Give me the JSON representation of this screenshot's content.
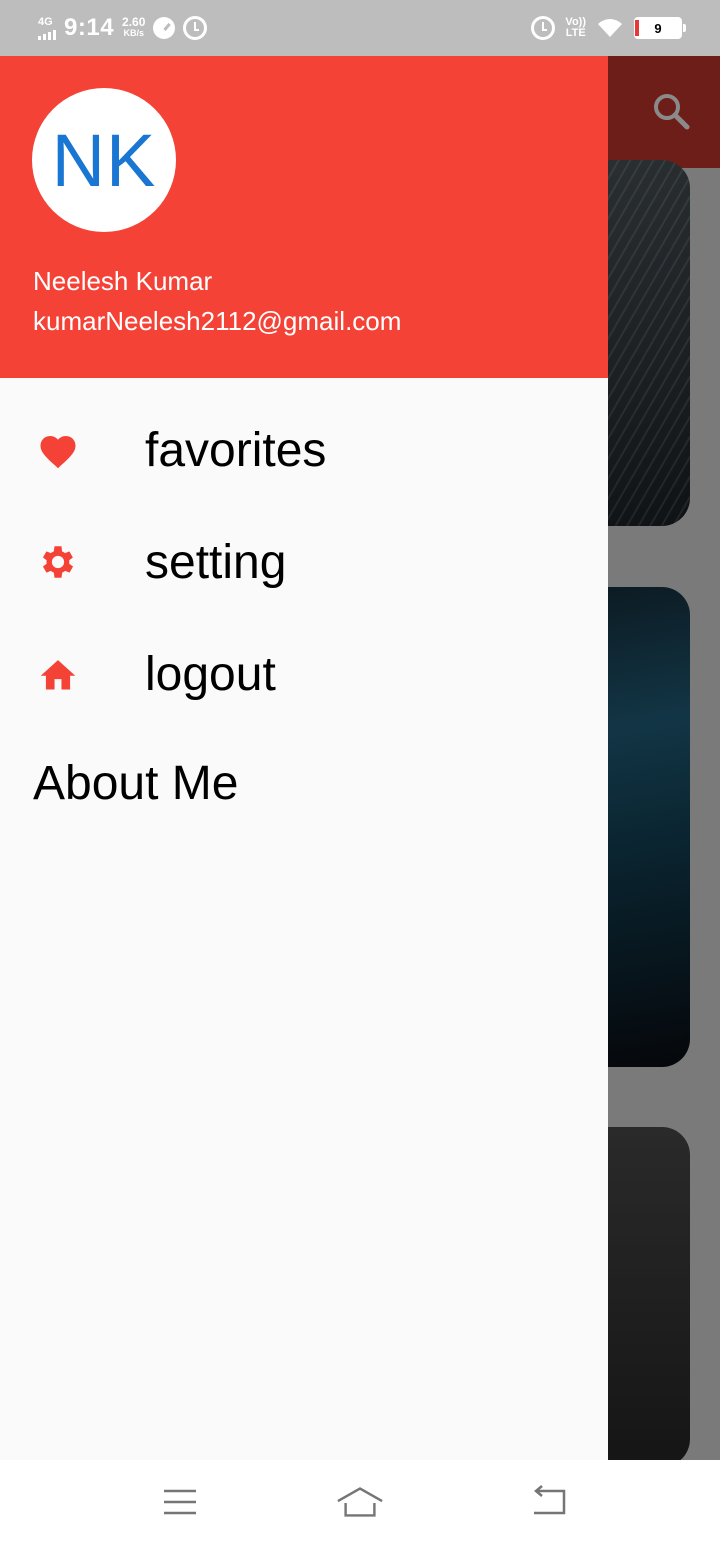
{
  "status_bar": {
    "network": "4G",
    "time": "9:14",
    "speed_value": "2.60",
    "speed_unit": "KB/s",
    "volte_top": "Vo))",
    "volte_bottom": "LTE",
    "battery": "9"
  },
  "drawer": {
    "avatar_initials": "NK",
    "user_name": "Neelesh Kumar",
    "user_email": "kumarNeelesh2112@gmail.com",
    "items": [
      {
        "label": "favorites",
        "icon": "heart-icon"
      },
      {
        "label": "setting",
        "icon": "gear-icon"
      },
      {
        "label": "logout",
        "icon": "home-icon"
      }
    ],
    "about_label": "About Me"
  },
  "colors": {
    "header": "#f44336",
    "accent_icon": "#f44336",
    "avatar_text": "#1976d2",
    "drawer_bg": "#fafafa"
  },
  "nav_bar": {
    "icons": [
      "menu-icon",
      "home-icon",
      "back-icon"
    ]
  }
}
